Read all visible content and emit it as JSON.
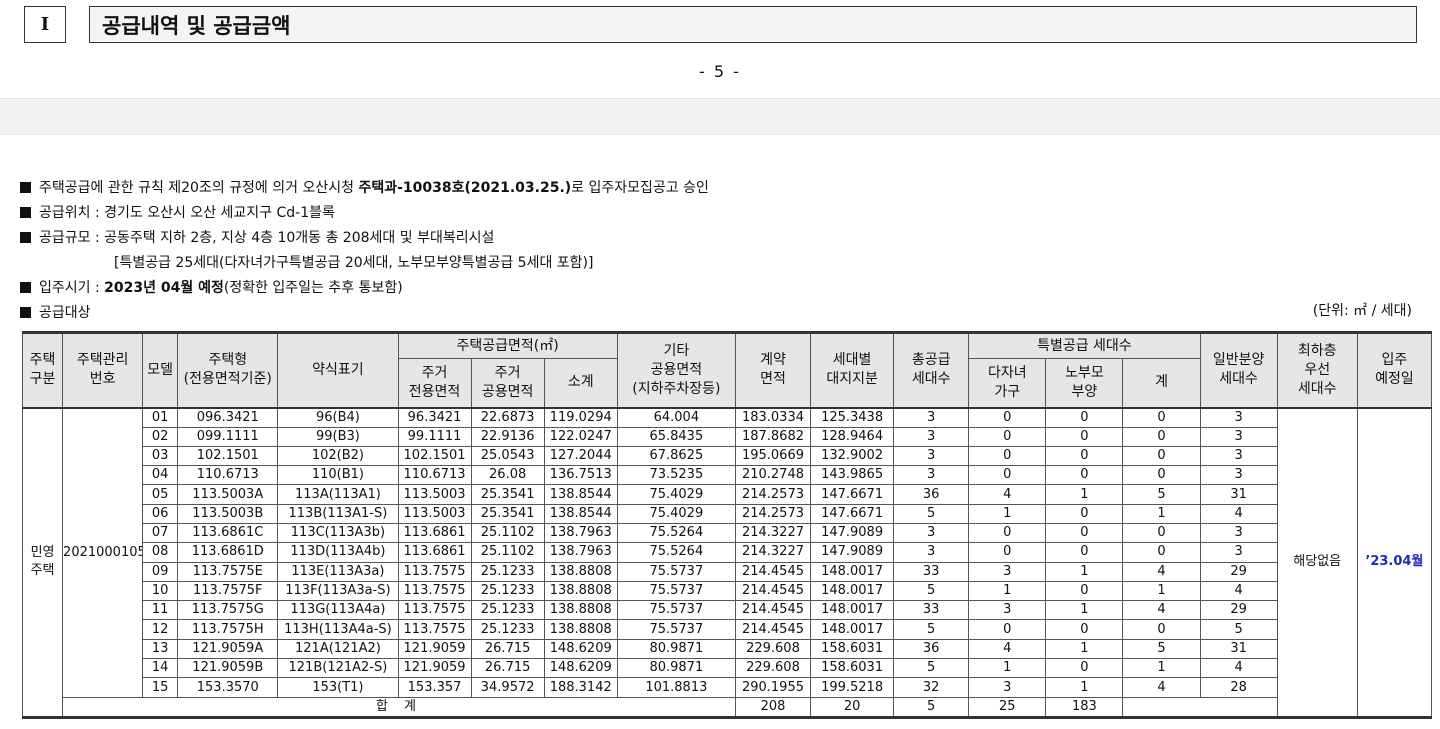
{
  "section": {
    "number": "I",
    "title": "공급내역 및 공급금액"
  },
  "page_number": "- 5 -",
  "notes": {
    "n1_pre": "주택공급에 관한 규칙 제20조의 규정에 의거 오산시청 ",
    "n1_bold": "주택과-10038호(2021.03.25.)",
    "n1_post": "로 입주자모집공고 승인",
    "n2": "공급위치 : 경기도 오산시 오산 세교지구 Cd-1블록",
    "n3": "공급규모 : 공동주택 지하 2층, 지상 4층 10개동 총 208세대 및 부대복리시설",
    "n3_sub": "[특별공급 25세대(다자녀가구특별공급 20세대, 노부모부양특별공급 5세대 포함)]",
    "n4_pre": "입주시기 : ",
    "n4_bold": "2023년 04월 예정",
    "n4_post": "(정확한 입주일는 추후 통보함)",
    "n5": "공급대상"
  },
  "unit": "(단위: ㎡ / 세대)",
  "table": {
    "headers": {
      "type": "주택\n구분",
      "mgmt_no": "주택관리\n번호",
      "model": "모델",
      "house_type": "주택형\n(전용면적기준)",
      "short": "약식표기",
      "area_group": "주택공급면적(㎡)",
      "exclusive": "주거\n전용면적",
      "common": "주거\n공용면적",
      "subtotal": "소계",
      "other": "기타\n공용면적\n(지하주차장등)",
      "contract": "계약\n면적",
      "land": "세대별\n대지지분",
      "total_units": "총공급\n세대수",
      "special_group": "특별공급 세대수",
      "multi_child": "다자녀\n가구",
      "elderly": "노부모\n부양",
      "special_sum": "계",
      "general": "일반분양\n세대수",
      "lowest_floor": "최하층\n우선\n세대수",
      "move_in": "입주\n예정일"
    },
    "category": "민영\n주택",
    "mgmt_number": "2021000105",
    "lowest_floor_value": "해당없음",
    "move_in_value": "’23.04월",
    "rows": [
      [
        "01",
        "096.3421",
        "96(B4)",
        "96.3421",
        "22.6873",
        "119.0294",
        "64.004",
        "183.0334",
        "125.3438",
        "3",
        "0",
        "0",
        "0",
        "3"
      ],
      [
        "02",
        "099.1111",
        "99(B3)",
        "99.1111",
        "22.9136",
        "122.0247",
        "65.8435",
        "187.8682",
        "128.9464",
        "3",
        "0",
        "0",
        "0",
        "3"
      ],
      [
        "03",
        "102.1501",
        "102(B2)",
        "102.1501",
        "25.0543",
        "127.2044",
        "67.8625",
        "195.0669",
        "132.9002",
        "3",
        "0",
        "0",
        "0",
        "3"
      ],
      [
        "04",
        "110.6713",
        "110(B1)",
        "110.6713",
        "26.08",
        "136.7513",
        "73.5235",
        "210.2748",
        "143.9865",
        "3",
        "0",
        "0",
        "0",
        "3"
      ],
      [
        "05",
        "113.5003A",
        "113A(113A1)",
        "113.5003",
        "25.3541",
        "138.8544",
        "75.4029",
        "214.2573",
        "147.6671",
        "36",
        "4",
        "1",
        "5",
        "31"
      ],
      [
        "06",
        "113.5003B",
        "113B(113A1-S)",
        "113.5003",
        "25.3541",
        "138.8544",
        "75.4029",
        "214.2573",
        "147.6671",
        "5",
        "1",
        "0",
        "1",
        "4"
      ],
      [
        "07",
        "113.6861C",
        "113C(113A3b)",
        "113.6861",
        "25.1102",
        "138.7963",
        "75.5264",
        "214.3227",
        "147.9089",
        "3",
        "0",
        "0",
        "0",
        "3"
      ],
      [
        "08",
        "113.6861D",
        "113D(113A4b)",
        "113.6861",
        "25.1102",
        "138.7963",
        "75.5264",
        "214.3227",
        "147.9089",
        "3",
        "0",
        "0",
        "0",
        "3"
      ],
      [
        "09",
        "113.7575E",
        "113E(113A3a)",
        "113.7575",
        "25.1233",
        "138.8808",
        "75.5737",
        "214.4545",
        "148.0017",
        "33",
        "3",
        "1",
        "4",
        "29"
      ],
      [
        "10",
        "113.7575F",
        "113F(113A3a-S)",
        "113.7575",
        "25.1233",
        "138.8808",
        "75.5737",
        "214.4545",
        "148.0017",
        "5",
        "1",
        "0",
        "1",
        "4"
      ],
      [
        "11",
        "113.7575G",
        "113G(113A4a)",
        "113.7575",
        "25.1233",
        "138.8808",
        "75.5737",
        "214.4545",
        "148.0017",
        "33",
        "3",
        "1",
        "4",
        "29"
      ],
      [
        "12",
        "113.7575H",
        "113H(113A4a-S)",
        "113.7575",
        "25.1233",
        "138.8808",
        "75.5737",
        "214.4545",
        "148.0017",
        "5",
        "0",
        "0",
        "0",
        "5"
      ],
      [
        "13",
        "121.9059A",
        "121A(121A2)",
        "121.9059",
        "26.715",
        "148.6209",
        "80.9871",
        "229.608",
        "158.6031",
        "36",
        "4",
        "1",
        "5",
        "31"
      ],
      [
        "14",
        "121.9059B",
        "121B(121A2-S)",
        "121.9059",
        "26.715",
        "148.6209",
        "80.9871",
        "229.608",
        "158.6031",
        "5",
        "1",
        "0",
        "1",
        "4"
      ],
      [
        "15",
        "153.3570",
        "153(T1)",
        "153.357",
        "34.9572",
        "188.3142",
        "101.8813",
        "290.1955",
        "199.5218",
        "32",
        "3",
        "1",
        "4",
        "28"
      ]
    ],
    "total": {
      "label": "합 계",
      "total_units": "208",
      "multi_child": "20",
      "elderly": "5",
      "special_sum": "25",
      "general": "183"
    }
  }
}
